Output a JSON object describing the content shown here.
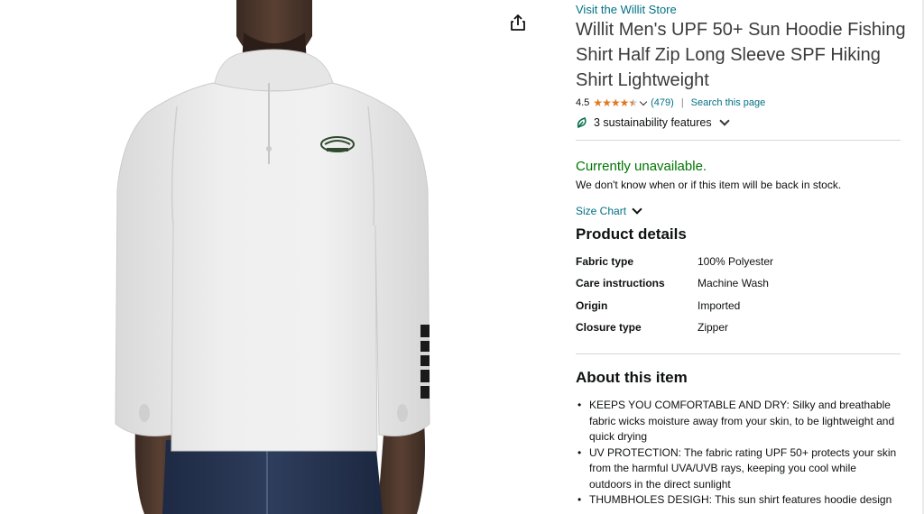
{
  "image": {
    "alt": "Willit Men's UPF 50+ Sun Hoodie product photo"
  },
  "share": {
    "icon": "share-icon"
  },
  "store_link": "Visit the Willit Store",
  "title": "Willit Men's UPF 50+ Sun Hoodie Fishing Shirt Half Zip Long Sleeve SPF Hiking Shirt Lightweight",
  "rating": {
    "value": "4.5",
    "stars": 4.5,
    "count": "(479)",
    "separator": "|",
    "search_link": "Search this page"
  },
  "sustainability": {
    "label": "3 sustainability features",
    "icon": "leaf-icon"
  },
  "availability": {
    "status": "Currently unavailable.",
    "note": "We don't know when or if this item will be back in stock."
  },
  "size_chart": "Size Chart",
  "product_details": {
    "heading": "Product details",
    "rows": [
      {
        "key": "Fabric type",
        "value": "100% Polyester"
      },
      {
        "key": "Care instructions",
        "value": "Machine Wash"
      },
      {
        "key": "Origin",
        "value": "Imported"
      },
      {
        "key": "Closure type",
        "value": "Zipper"
      }
    ]
  },
  "about": {
    "heading": "About this item",
    "items": [
      "KEEPS YOU COMFORTABLE AND DRY: Silky and breathable fabric wicks moisture away from your skin, to be lightweight and quick drying",
      "UV PROTECTION: The fabric rating UPF 50+ protects your skin from the harmful UVA/UVB rays, keeping you cool while outdoors in the direct sunlight",
      "THUMBHOLES DESIGH: This sun shirt features hoodie design"
    ]
  },
  "colors": {
    "link": "#007185",
    "available_green": "#007600",
    "star": "#de7921",
    "text": "#0f1111"
  }
}
